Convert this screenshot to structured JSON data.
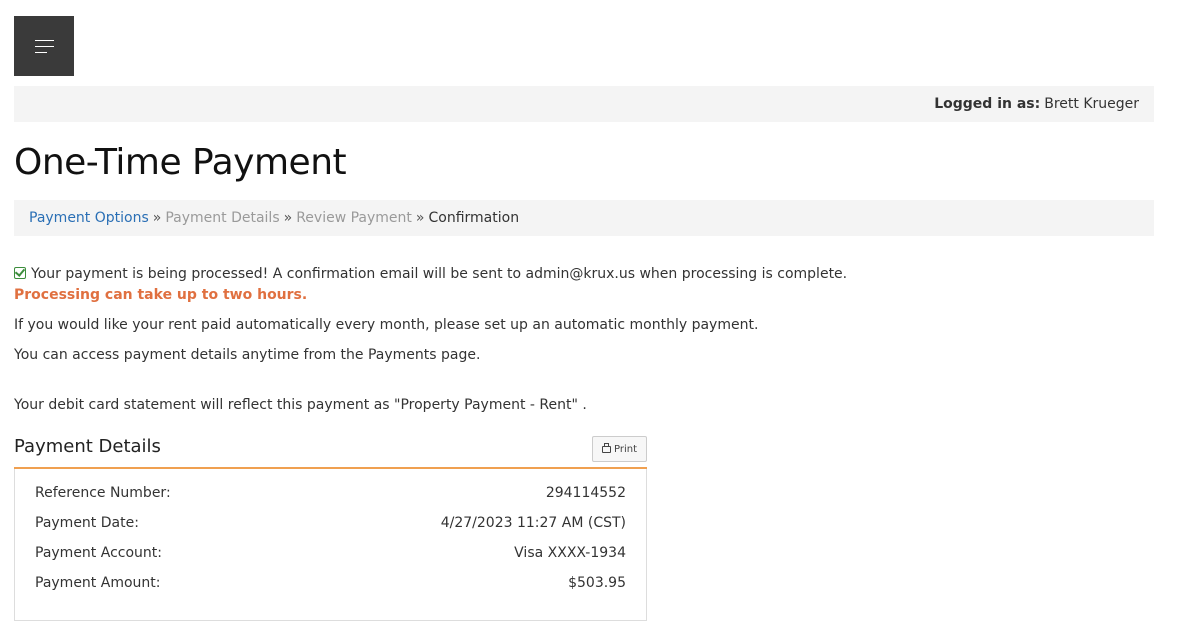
{
  "header": {
    "menu_icon": "hamburger-menu-icon",
    "logged_in_label": "Logged in as:",
    "user_name": "Brett Krueger"
  },
  "page": {
    "title": "One-Time Payment"
  },
  "breadcrumb": {
    "items": [
      {
        "label": "Payment Options",
        "state": "link"
      },
      {
        "label": "Payment Details",
        "state": "muted"
      },
      {
        "label": "Review Payment",
        "state": "muted"
      },
      {
        "label": "Confirmation",
        "state": "current"
      }
    ],
    "separator": "»"
  },
  "messages": {
    "processing": "Your payment is being processed! A confirmation email will be sent to admin@krux.us when processing is complete.",
    "processing_time": "Processing can take up to two hours.",
    "autopay": "If you would like your rent paid automatically every month, please set up an automatic monthly payment.",
    "access": "You can access payment details anytime from the Payments page.",
    "statement": "Your debit card statement will reflect this payment as \"Property Payment - Rent\" ."
  },
  "details": {
    "title": "Payment Details",
    "print_label": "Print",
    "rows": [
      {
        "label": "Reference Number:",
        "value": "294114552"
      },
      {
        "label": "Payment Date:",
        "value": "4/27/2023 11:27 AM (CST)"
      },
      {
        "label": "Payment Account:",
        "value": "Visa XXXX-1934"
      },
      {
        "label": "Payment Amount:",
        "value": "$503.95"
      }
    ]
  },
  "colors": {
    "menu_bg": "#3a3a3a",
    "link": "#2a6fb5",
    "warning": "#e07040",
    "success_check": "#3c8d3c",
    "accent_rule": "#f0a050"
  }
}
